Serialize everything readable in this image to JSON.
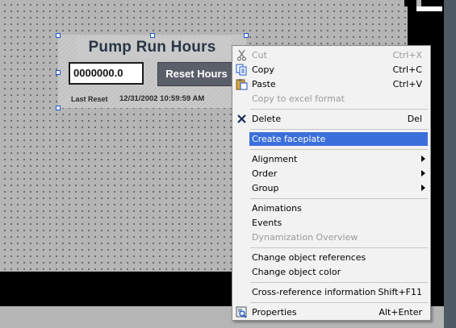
{
  "faceplate": {
    "title": "Pump Run Hours",
    "value": "0000000.0",
    "reset_button": "Reset Hours",
    "last_reset_label": "Last Reset",
    "last_reset_value": "12/31/2002 10:59:59 AM"
  },
  "context_menu": {
    "cut": {
      "label": "Cut",
      "shortcut": "Ctrl+X"
    },
    "copy": {
      "label": "Copy",
      "shortcut": "Ctrl+C"
    },
    "paste": {
      "label": "Paste",
      "shortcut": "Ctrl+V"
    },
    "copy_excel": {
      "label": "Copy to excel format"
    },
    "delete": {
      "label": "Delete",
      "shortcut": "Del"
    },
    "create_faceplate": {
      "label": "Create faceplate"
    },
    "alignment": {
      "label": "Alignment"
    },
    "order": {
      "label": "Order"
    },
    "group": {
      "label": "Group"
    },
    "animations": {
      "label": "Animations"
    },
    "events": {
      "label": "Events"
    },
    "dynamization": {
      "label": "Dynamization Overview"
    },
    "change_refs": {
      "label": "Change object references"
    },
    "change_color": {
      "label": "Change object color"
    },
    "cross_ref": {
      "label": "Cross-reference information",
      "shortcut": "Shift+F11"
    },
    "properties": {
      "label": "Properties",
      "shortcut": "Alt+Enter"
    }
  },
  "icons": {
    "cut": "scissors-icon",
    "copy": "copy-icon",
    "paste": "paste-icon",
    "delete": "delete-x-icon",
    "properties": "properties-icon"
  },
  "colors": {
    "highlight": "#3b6fdb",
    "selection_handle": "#1c57c6",
    "reset_button": "#5b5f69",
    "title_text": "#2a3545"
  }
}
